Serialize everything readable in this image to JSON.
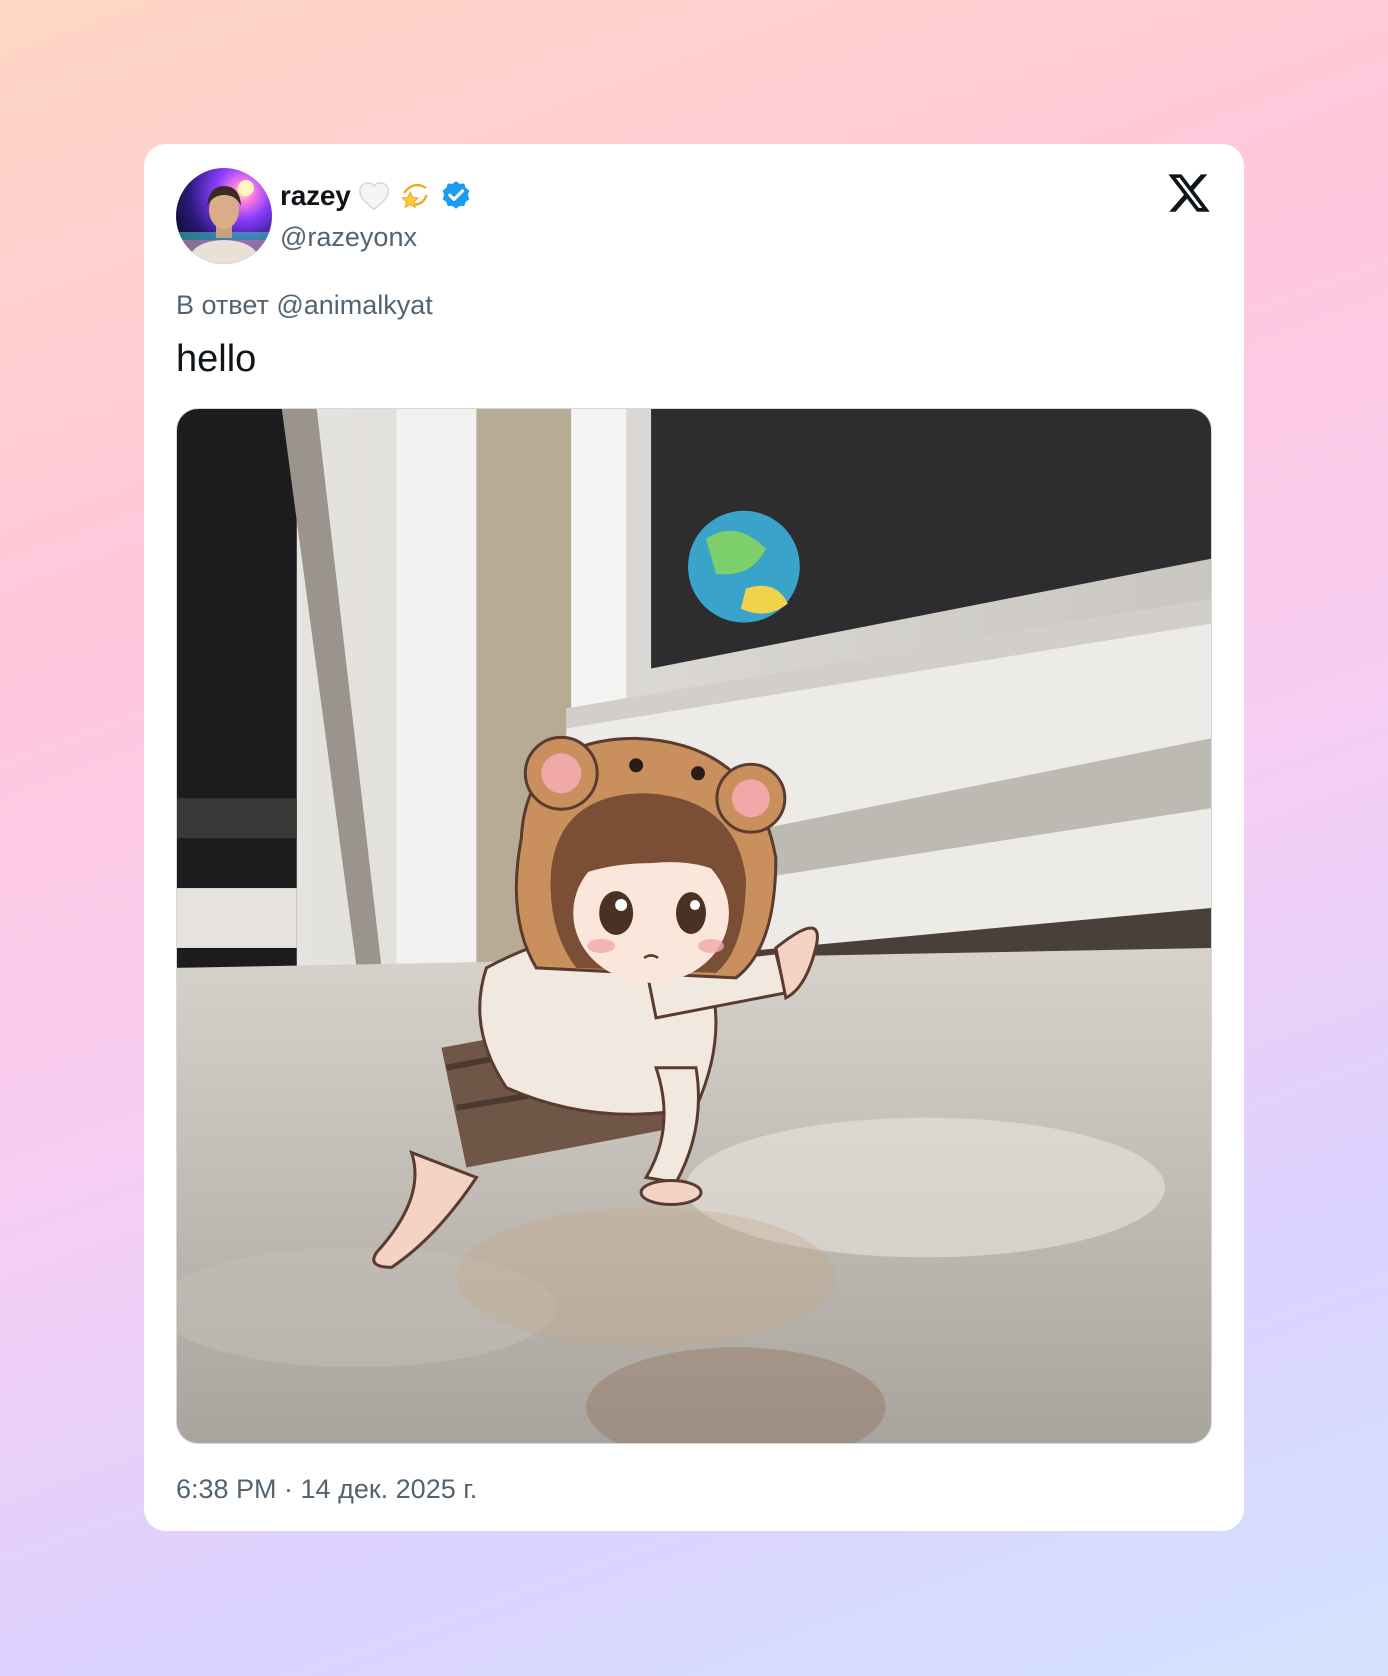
{
  "tweet": {
    "display_name": "razey",
    "name_emojis": [
      "white-heart-icon",
      "dizzy-star-icon"
    ],
    "verified": true,
    "handle": "@razeyonx",
    "reply_to": "В ответ @animalkyat",
    "text": "hello",
    "timestamp": "6:38 PM · 14 дек. 2025 г.",
    "media": {
      "type": "image"
    }
  },
  "brand": {
    "logo": "x-logo-icon",
    "verified_color": "#1d9bf0"
  }
}
